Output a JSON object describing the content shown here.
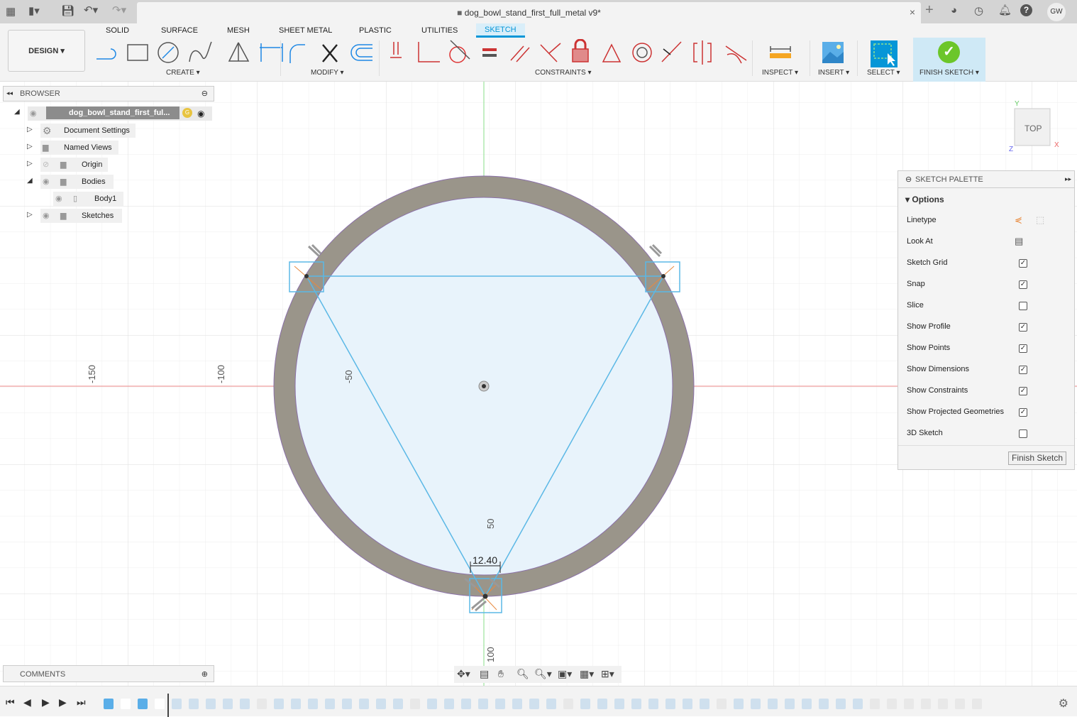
{
  "window": {
    "title": "dog_bowl_stand_first_full_metal v9*",
    "user_initials": "GW"
  },
  "ribbon": {
    "workspace": "DESIGN",
    "tabs": [
      "SOLID",
      "SURFACE",
      "MESH",
      "SHEET METAL",
      "PLASTIC",
      "UTILITIES",
      "SKETCH"
    ],
    "active_tab": "SKETCH",
    "groups": {
      "create": "CREATE",
      "modify": "MODIFY",
      "constraints": "CONSTRAINTS",
      "inspect": "INSPECT",
      "insert": "INSERT",
      "select": "SELECT",
      "finish": "FINISH SKETCH"
    }
  },
  "browser": {
    "title": "BROWSER",
    "root": "dog_bowl_stand_first_ful...",
    "items": [
      {
        "label": "Document Settings"
      },
      {
        "label": "Named Views"
      },
      {
        "label": "Origin"
      },
      {
        "label": "Bodies"
      },
      {
        "label": "Body1"
      },
      {
        "label": "Sketches"
      }
    ]
  },
  "canvas": {
    "axis_labels": [
      "-150",
      "-100",
      "-50",
      "50",
      "100"
    ],
    "dimension": "12.40",
    "viewcube": {
      "face": "TOP",
      "x": "X",
      "y": "Y",
      "z": "Z"
    }
  },
  "palette": {
    "title": "SKETCH PALETTE",
    "section": "Options",
    "rows": [
      {
        "label": "Linetype",
        "type": "icons"
      },
      {
        "label": "Look At",
        "type": "icon"
      },
      {
        "label": "Sketch Grid",
        "checked": true
      },
      {
        "label": "Snap",
        "checked": true
      },
      {
        "label": "Slice",
        "checked": false
      },
      {
        "label": "Show Profile",
        "checked": true
      },
      {
        "label": "Show Points",
        "checked": true
      },
      {
        "label": "Show Dimensions",
        "checked": true
      },
      {
        "label": "Show Constraints",
        "checked": true
      },
      {
        "label": "Show Projected Geometries",
        "checked": true
      },
      {
        "label": "3D Sketch",
        "checked": false
      }
    ],
    "finish_button": "Finish Sketch"
  },
  "comments": {
    "title": "COMMENTS"
  },
  "colors": {
    "accent": "#0696d7",
    "sketch_line": "#5bb8e6",
    "body": "#9a958a",
    "profile": "#e8f3fb",
    "x_axis": "#e06060",
    "y_axis": "#60d060",
    "finish_check": "#6cc62a"
  }
}
